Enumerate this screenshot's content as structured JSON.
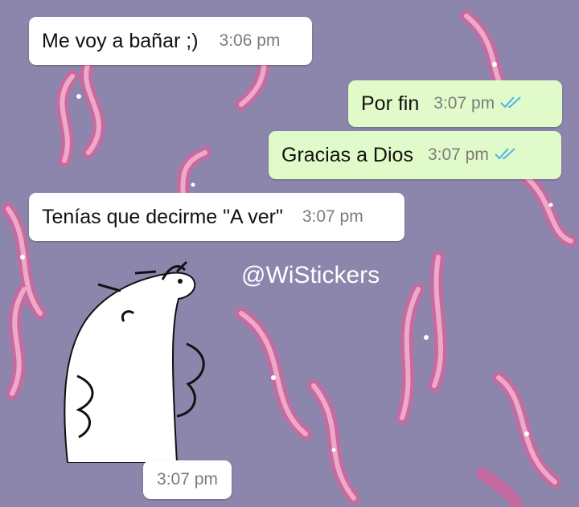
{
  "colors": {
    "background": "#8c86ad",
    "incoming_bubble": "#ffffff",
    "outgoing_bubble": "#e1fac9",
    "read_ticks": "#4fb3e8",
    "flames": "#e98bb3"
  },
  "messages": [
    {
      "direction": "incoming",
      "text": "Me voy a bañar ;)",
      "time": "3:06 pm"
    },
    {
      "direction": "outgoing",
      "text": "Por fin",
      "time": "3:07 pm",
      "status_icon": "double-check-read-icon"
    },
    {
      "direction": "outgoing",
      "text": "Gracias a Dios",
      "time": "3:07 pm",
      "status_icon": "double-check-read-icon"
    },
    {
      "direction": "incoming",
      "text": "Tenías que decirme \"A ver\"",
      "time": "3:07 pm"
    }
  ],
  "sticker": {
    "icon": "doodle-creature-sticker",
    "time": "3:07 pm"
  },
  "watermark": "@WiStickers"
}
